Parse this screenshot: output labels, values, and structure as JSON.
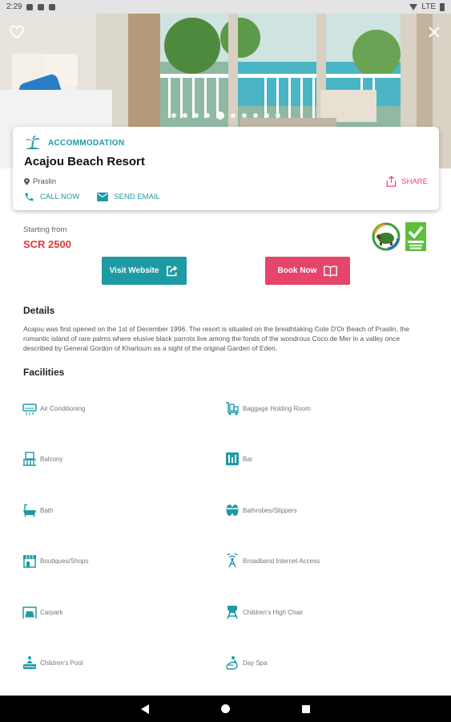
{
  "status_bar": {
    "time": "2:29",
    "network": "LTE"
  },
  "hero": {
    "image_count": 10,
    "active_image_index": 4
  },
  "listing": {
    "category": "ACCOMMODATION",
    "title": "Acajou Beach Resort",
    "location": "Praslin",
    "share_label": "SHARE",
    "call_label": "CALL NOW",
    "email_label": "SEND EMAIL"
  },
  "price": {
    "label": "Starting from",
    "value": "SCR 2500"
  },
  "buttons": {
    "visit_label": "Visit Website",
    "book_label": "Book Now"
  },
  "details": {
    "title": "Details",
    "text": "Acajou was first opened on the 1st of December 1996. The resort is situated on the breathtaking Cote D'Or Beach of Praslin, the romantic island of rare palms where elusive black parrots live among the fonds of the wondrous Coco de Mer in a valley once described by General Gordon of Khartoum as a sight of the original Garden of Eden."
  },
  "facilities": {
    "title": "Facilities",
    "items": [
      {
        "label": "Air Conditioning",
        "icon": "air-conditioner-icon"
      },
      {
        "label": "Baggage Holding Room",
        "icon": "luggage-cart-icon"
      },
      {
        "label": "Balcony",
        "icon": "balcony-icon"
      },
      {
        "label": "Bar",
        "icon": "bar-icon"
      },
      {
        "label": "Bath",
        "icon": "bathtub-icon"
      },
      {
        "label": "Bathrobes/Slippers",
        "icon": "slippers-icon"
      },
      {
        "label": "Boutiques/Shops",
        "icon": "shop-icon"
      },
      {
        "label": "Broadband Internet Access",
        "icon": "wifi-tower-icon"
      },
      {
        "label": "Carpark",
        "icon": "carpark-icon"
      },
      {
        "label": "Children's High Chair",
        "icon": "high-chair-icon"
      },
      {
        "label": "Children's Pool",
        "icon": "pool-icon"
      },
      {
        "label": "Day Spa",
        "icon": "spa-icon"
      }
    ]
  },
  "colors": {
    "teal": "#1e9aa5",
    "pink": "#e5456a",
    "price_red": "#e53935"
  }
}
